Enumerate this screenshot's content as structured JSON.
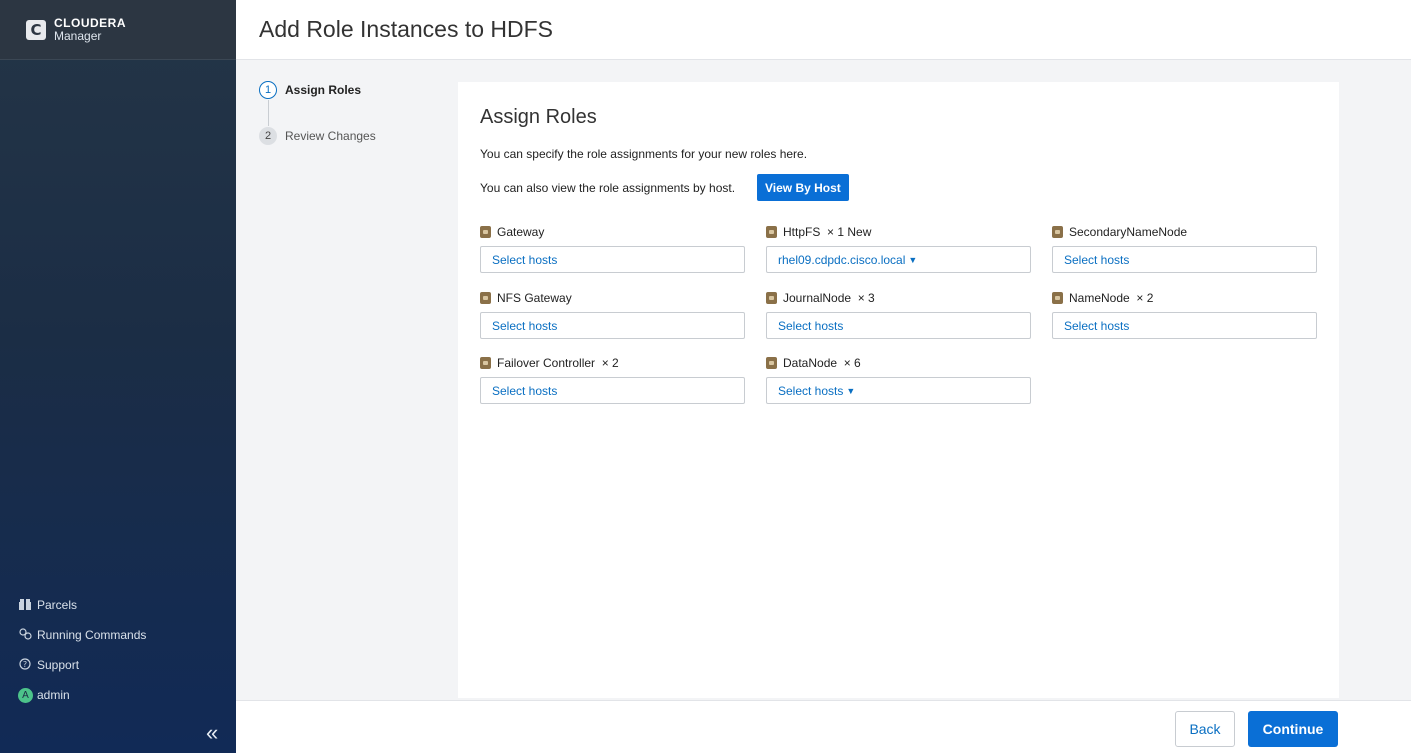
{
  "sidebar": {
    "logo_letter": "C",
    "brand": "CLOUDERA",
    "product": "Manager",
    "items": [
      {
        "label": "Parcels",
        "icon": "parcels-icon"
      },
      {
        "label": "Running Commands",
        "icon": "running-commands-icon"
      },
      {
        "label": "Support",
        "icon": "support-icon"
      },
      {
        "label": "admin",
        "icon": "avatar"
      }
    ],
    "avatar_letter": "A",
    "collapse_glyph": "«"
  },
  "header": {
    "title": "Add Role Instances to HDFS"
  },
  "steps": [
    {
      "num": "1",
      "label": "Assign Roles",
      "active": true
    },
    {
      "num": "2",
      "label": "Review Changes",
      "active": false
    }
  ],
  "main": {
    "title": "Assign Roles",
    "description": "You can specify the role assignments for your new roles here.",
    "view_by_host_text": "You can also view the role assignments by host.",
    "view_by_host_button": "View By Host",
    "roles": [
      {
        "name": "Gateway",
        "count": "",
        "value": "Select hosts",
        "dropdown": false
      },
      {
        "name": "HttpFS",
        "count": "× 1 New",
        "value": "rhel09.cdpdc.cisco.local",
        "dropdown": true
      },
      {
        "name": "SecondaryNameNode",
        "count": "",
        "value": "Select hosts",
        "dropdown": false
      },
      {
        "name": "NFS Gateway",
        "count": "",
        "value": "Select hosts",
        "dropdown": false
      },
      {
        "name": "JournalNode",
        "count": "× 3",
        "value": "Select hosts",
        "dropdown": false
      },
      {
        "name": "NameNode",
        "count": "× 2",
        "value": "Select hosts",
        "dropdown": false
      },
      {
        "name": "Failover Controller",
        "count": "× 2",
        "value": "Select hosts",
        "dropdown": false
      },
      {
        "name": "DataNode",
        "count": "× 6",
        "value": "Select hosts",
        "dropdown": true
      }
    ]
  },
  "footer": {
    "back_label": "Back",
    "continue_label": "Continue"
  },
  "colors": {
    "accent": "#0a6fd6",
    "link": "#0a6fc2",
    "sidebar_top": "#243547",
    "sidebar_bottom": "#112a56"
  }
}
